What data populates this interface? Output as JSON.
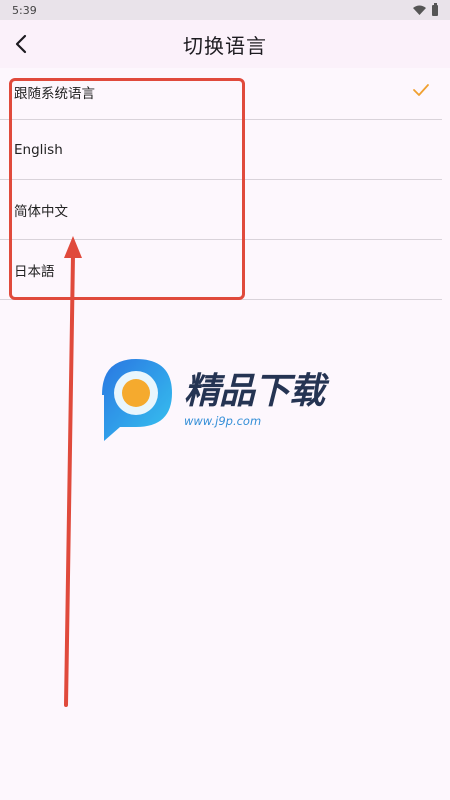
{
  "status_bar": {
    "time": "5:39",
    "icons": [
      "wifi-icon",
      "battery-icon"
    ]
  },
  "app_bar": {
    "title": "切换语言",
    "back_icon": "chevron-left-icon"
  },
  "languages": [
    {
      "label": "跟随系统语言",
      "selected": true
    },
    {
      "label": "English",
      "selected": false
    },
    {
      "label": "简体中文",
      "selected": false
    },
    {
      "label": "日本語",
      "selected": false
    }
  ],
  "watermark": {
    "title": "精品下载",
    "url": "www.j9p.com"
  },
  "colors": {
    "accent_check": "#f0a030",
    "annotation_red": "#e04a3c",
    "background": "#fdf7fd",
    "divider": "#d9d3da"
  }
}
